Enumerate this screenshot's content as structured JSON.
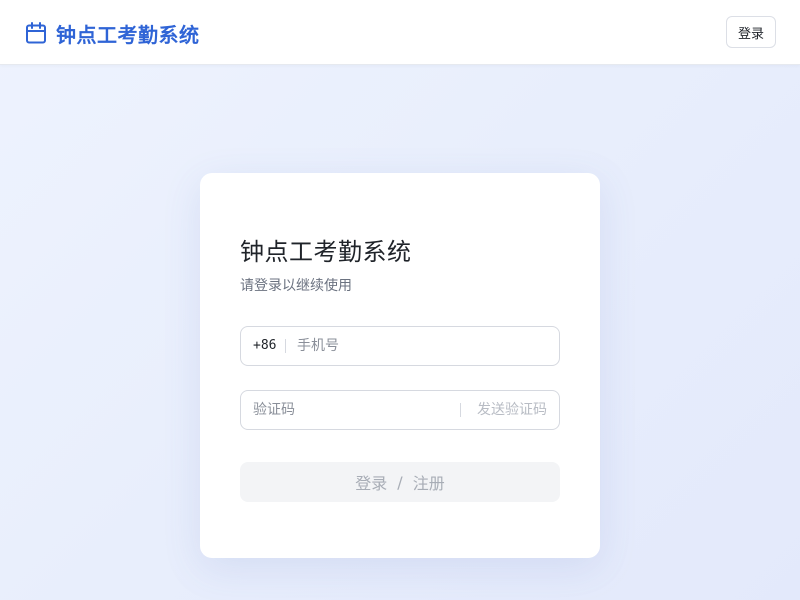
{
  "header": {
    "app_title": "钟点工考勤系统",
    "brand_icon": "calendar-icon",
    "login_label": "登录"
  },
  "login_card": {
    "title": "钟点工考勤系统",
    "subtitle": "请登录以继续使用",
    "phone": {
      "prefix": "+86",
      "placeholder": "手机号",
      "value": ""
    },
    "code": {
      "placeholder": "验证码",
      "value": "",
      "send_label": "发送验证码"
    },
    "submit": {
      "login": "登录",
      "separator": "/",
      "register": "注册"
    }
  },
  "colors": {
    "accent": "#2f64d6",
    "background": "#eaf0fd",
    "disabled_button": "#f3f4f6"
  }
}
